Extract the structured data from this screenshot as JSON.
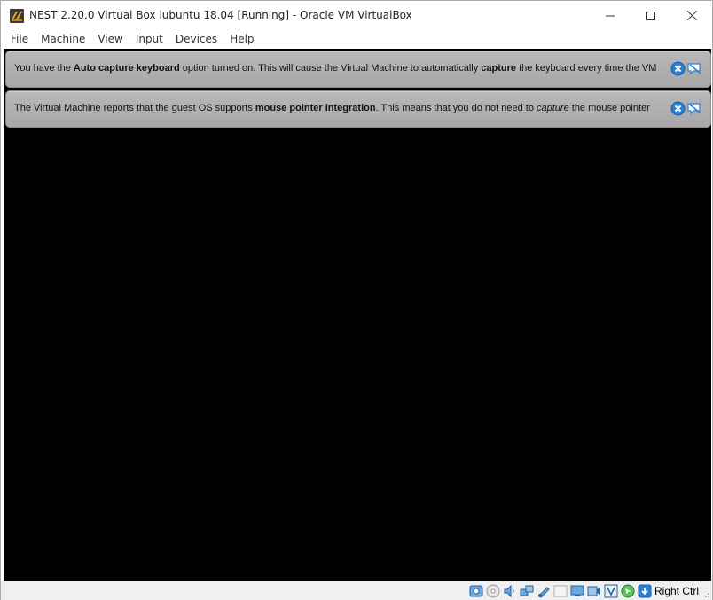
{
  "window": {
    "title": "NEST 2.20.0 Virtual Box lubuntu 18.04 [Running] - Oracle VM VirtualBox"
  },
  "menu": {
    "items": [
      "File",
      "Machine",
      "View",
      "Input",
      "Devices",
      "Help"
    ]
  },
  "banners": [
    {
      "pre": "You have the ",
      "bold1": "Auto capture keyboard",
      "mid": " option turned on. This will cause the Virtual Machine to automatically ",
      "bold2": "capture",
      "post": " the keyboard every time the VM"
    },
    {
      "pre": "The Virtual Machine reports that the guest OS supports ",
      "bold1": "mouse pointer integration",
      "mid": ". This means that you do not need to ",
      "italic": "capture",
      "post": " the mouse pointer"
    }
  ],
  "statusbar": {
    "host_key": "Right Ctrl",
    "icons": [
      "hard-disk-icon",
      "optical-drive-icon",
      "audio-icon",
      "network-icon",
      "usb-icon",
      "shared-folders-icon",
      "display-icon",
      "video-capture-icon",
      "virtualization-icon",
      "mouse-integration-icon",
      "keyboard-capture-icon"
    ]
  },
  "colors": {
    "vm_screen": "#000000",
    "banner_bg": "#b0b0b0",
    "accent_blue": "#2a7fd4"
  }
}
